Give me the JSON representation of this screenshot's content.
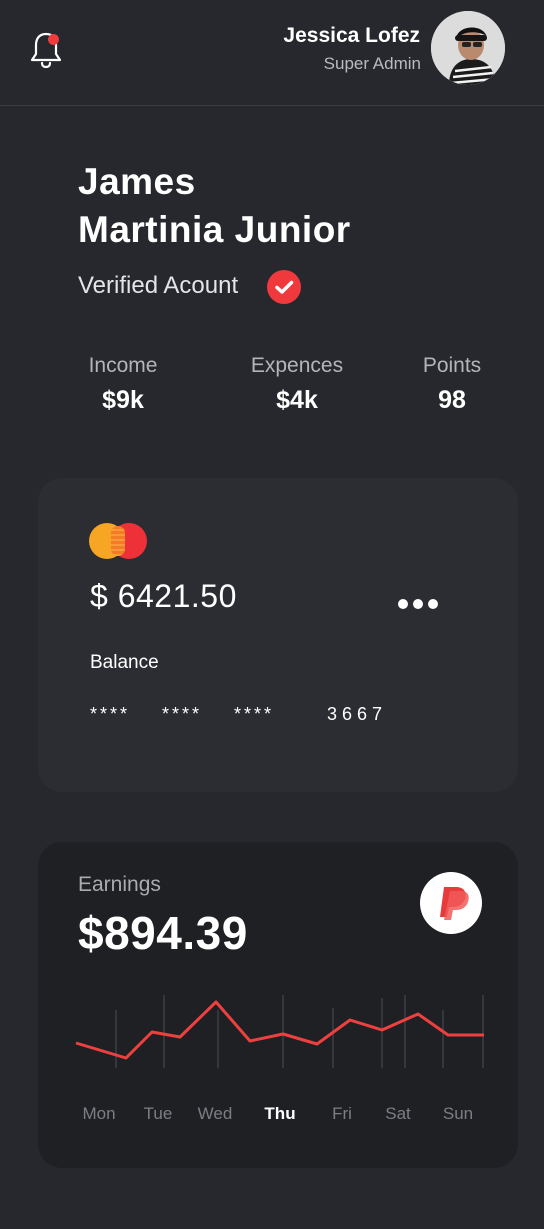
{
  "header": {
    "user_name": "Jessica Lofez",
    "user_role": "Super Admin",
    "notification_dot": true
  },
  "profile": {
    "name_line1": "James",
    "name_line2": "Martinia Junior",
    "verified_label": "Verified Acount"
  },
  "stats": [
    {
      "label": "Income",
      "value": "$9k"
    },
    {
      "label": "Expences",
      "value": "$4k"
    },
    {
      "label": "Points",
      "value": "98"
    }
  ],
  "card": {
    "brand_icon": "mastercard-icon",
    "amount": "$ 6421.50",
    "balance_label": "Balance",
    "number_groups": [
      "****",
      "****",
      "****",
      "3667"
    ]
  },
  "earnings": {
    "label": "Earnings",
    "amount": "$894.39",
    "provider_icon": "paypal-icon",
    "days": [
      "Mon",
      "Tue",
      "Wed",
      "Thu",
      "Fri",
      "Sat",
      "Sun"
    ],
    "active_day": "Thu"
  },
  "colors": {
    "background": "#26282d",
    "card": "#2b2d33",
    "earnings_card": "#1f2024",
    "accent_red": "#ef3b3b",
    "mastercard_orange": "#f6a623",
    "mastercard_red": "#ee3038"
  }
}
